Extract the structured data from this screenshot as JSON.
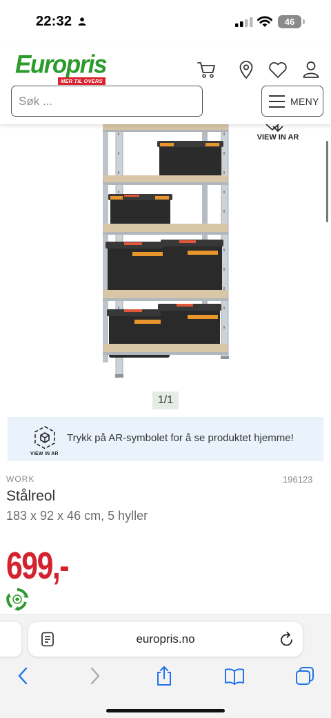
{
  "status_bar": {
    "time": "22:32",
    "battery": "46"
  },
  "header": {
    "logo_text": "Europris",
    "logo_tagline": "MER TIL OVERS",
    "search_placeholder": "Søk ...",
    "menu_label": "MENY",
    "icons": [
      "cart-icon",
      "location-pin-icon",
      "heart-icon",
      "user-icon"
    ]
  },
  "gallery": {
    "view_in_ar_label": "VIEW IN AR",
    "counter": "1/1"
  },
  "ar_banner": {
    "icon_label": "VIEW IN AR",
    "text": "Trykk på AR-symbolet for å se produktet hjemme!"
  },
  "product": {
    "brand": "WORK",
    "sku": "196123",
    "name": "Stålreol",
    "description": "183 x 92 x 46 cm, 5 hyller",
    "price": "699,-"
  },
  "browser": {
    "url": "europris.no",
    "nav_icons": [
      "back-icon",
      "forward-icon",
      "share-icon",
      "bookmarks-icon",
      "tabs-icon"
    ]
  },
  "colors": {
    "brand_green": "#2c9a2c",
    "brand_red": "#d4222e",
    "banner_blue": "#eaf3fb",
    "counter_bg": "#e3ede5"
  }
}
